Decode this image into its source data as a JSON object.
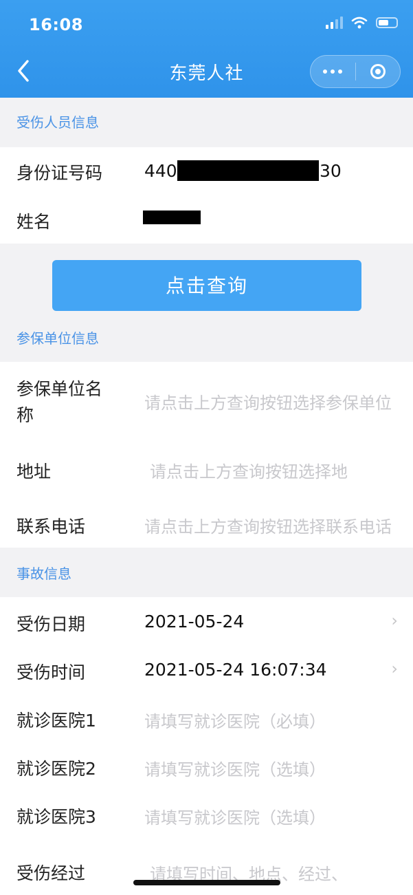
{
  "status": {
    "time": "16:08"
  },
  "nav": {
    "title": "东莞人社"
  },
  "sections": {
    "injured": "受伤人员信息",
    "employer": "参保单位信息",
    "accident": "事故信息"
  },
  "injured": {
    "id_label": "身份证号码",
    "id_prefix": "440",
    "id_suffix": "30",
    "name_label": "姓名"
  },
  "query_button": "点击查询",
  "employer": {
    "name_label_line1": "参保单位名",
    "name_label_line2": "称",
    "name_placeholder": "请点击上方查询按钮选择参保单位",
    "address_label": "地址",
    "address_placeholder": "请点击上方查询按钮选择地",
    "phone_label": "联系电话",
    "phone_placeholder": "请点击上方查询按钮选择联系电话"
  },
  "accident": {
    "date_label": "受伤日期",
    "date_value": "2021-05-24",
    "time_label": "受伤时间",
    "time_value": "2021-05-24 16:07:34",
    "hospital1_label": "就诊医院1",
    "hospital1_placeholder": "请填写就诊医院（必填）",
    "hospital2_label": "就诊医院2",
    "hospital2_placeholder": "请填写就诊医院（选填）",
    "hospital3_label": "就诊医院3",
    "hospital3_placeholder": "请填写就诊医院（选填）",
    "process_label": "受伤经过",
    "process_placeholder": "请填写时间、地点、经过、"
  },
  "icons": {
    "back": "chevron-left-icon",
    "more": "more-dots-icon",
    "close": "target-close-icon",
    "arrow": "chevron-right-icon"
  }
}
